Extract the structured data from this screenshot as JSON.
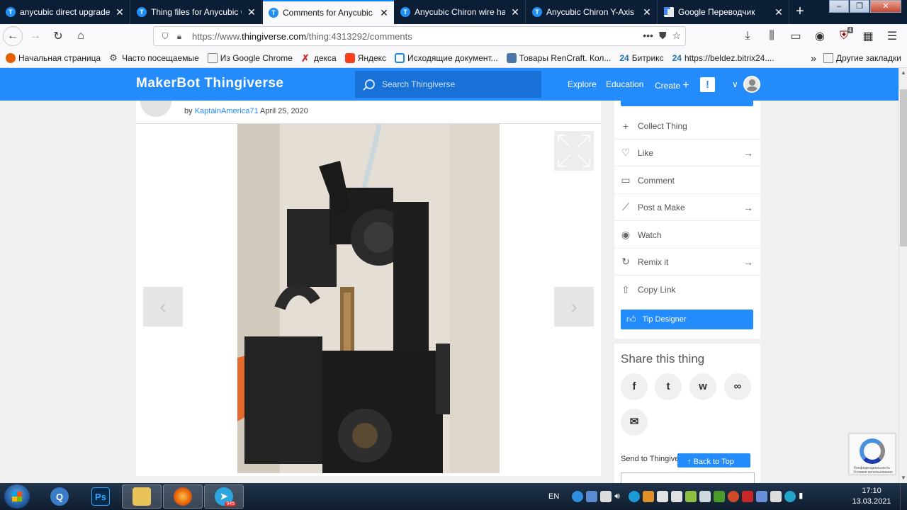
{
  "browser": {
    "tabs": [
      {
        "title": "anycubic direct upgrade-",
        "active": false
      },
      {
        "title": "Thing files for Anycubic C",
        "active": false
      },
      {
        "title": "Comments for Anycubic C",
        "active": true
      },
      {
        "title": "Anycubic Chiron wire har",
        "active": false
      },
      {
        "title": "Anycubic Chiron Y-Axis st",
        "active": false
      },
      {
        "title": "Google Переводчик",
        "active": false
      }
    ],
    "url_prefix": "https://www.",
    "url_domain": "thingiverse.com",
    "url_path": "/thing:4313292/comments",
    "addon_badge": "4",
    "bookmarks": [
      {
        "label": "Начальная страница",
        "icon": "firefox-icon"
      },
      {
        "label": "Часто посещаемые",
        "icon": "gear-icon"
      },
      {
        "label": "Из Google Chrome",
        "icon": "folder-icon"
      },
      {
        "label": "декса",
        "icon": "x-icon"
      },
      {
        "label": "Яндекс",
        "icon": "yandex-icon"
      },
      {
        "label": "Исходящие документ...",
        "icon": "document-icon"
      },
      {
        "label": "Товары RenCraft. Кол...",
        "icon": "vk-icon"
      },
      {
        "label": "Битрикс",
        "icon": "bitrix-icon",
        "prefix": "24"
      },
      {
        "label": "https://beldez.bitrix24....",
        "icon": "bitrix-icon",
        "prefix": "24"
      }
    ],
    "other_bookmarks": "Другие закладки"
  },
  "site": {
    "logo_maker": "MakerBot",
    "logo_thing": "Thingiverse",
    "search_placeholder": "Search Thingiverse",
    "nav": [
      "Explore",
      "Education",
      "Create"
    ],
    "alert_glyph": "!"
  },
  "thing": {
    "byline_prefix": "by",
    "author": "KaptainAmerica71",
    "date": "April 25, 2020"
  },
  "gallery": {
    "prev_glyph": "‹",
    "next_glyph": "›"
  },
  "sidebar": {
    "actions": [
      {
        "label": "Collect Thing",
        "icon": "plus-icon",
        "arrow": false
      },
      {
        "label": "Like",
        "icon": "heart-icon",
        "arrow": true
      },
      {
        "label": "Comment",
        "icon": "comment-icon",
        "arrow": false
      },
      {
        "label": "Post a Make",
        "icon": "make-icon",
        "arrow": true
      },
      {
        "label": "Watch",
        "icon": "eye-icon",
        "arrow": false
      },
      {
        "label": "Remix it",
        "icon": "remix-icon",
        "arrow": true
      },
      {
        "label": "Copy Link",
        "icon": "share-icon",
        "arrow": false
      }
    ],
    "tip_label": "Tip Designer"
  },
  "share": {
    "title": "Share this thing",
    "send_to": "Send to Thingiverse",
    "back_to_top": "Back to Top",
    "icons": [
      {
        "name": "facebook-icon",
        "glyph": "f"
      },
      {
        "name": "twitter-icon",
        "glyph": "t"
      },
      {
        "name": "whatsapp-icon",
        "glyph": "w"
      },
      {
        "name": "link-icon",
        "glyph": "∞"
      },
      {
        "name": "email-icon",
        "glyph": "✉"
      }
    ]
  },
  "recaptcha": {
    "text": "Конфиденциальность - Условия использования"
  },
  "taskbar": {
    "lang": "EN",
    "telegram_badge": "945",
    "time": "17:10",
    "date": "13.03.2021"
  },
  "colors": {
    "brand": "#248bfb",
    "tab_bg": "#0c1d36"
  }
}
